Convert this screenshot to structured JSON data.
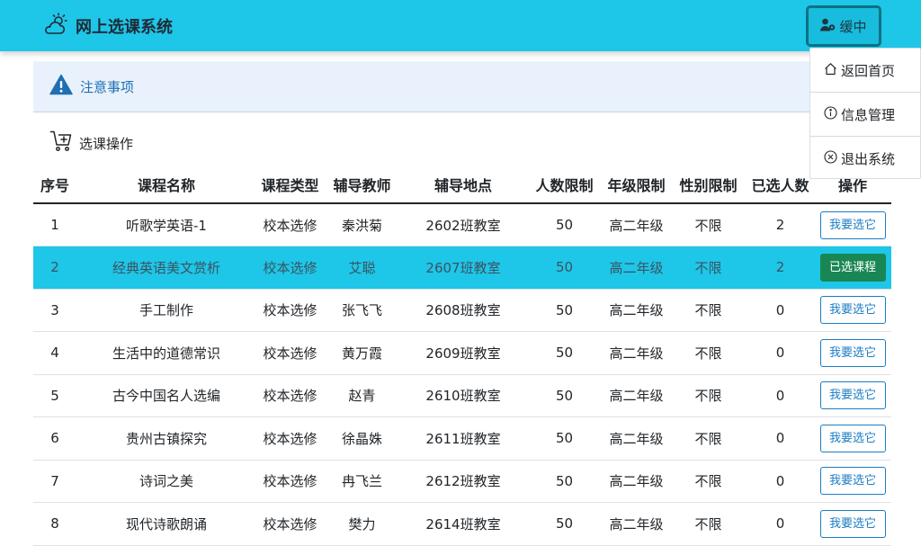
{
  "app": {
    "title": "网上选课系统",
    "logo_icon": "cloud-sun-icon"
  },
  "user": {
    "name": "缓中",
    "icon": "user-gear-icon"
  },
  "user_menu": [
    {
      "label": "返回首页",
      "icon": "home-icon"
    },
    {
      "label": "信息管理",
      "icon": "info-icon"
    },
    {
      "label": "退出系统",
      "icon": "close-circle-icon"
    }
  ],
  "notice": {
    "label": "注意事项",
    "icon": "warning-icon"
  },
  "operations": {
    "label": "选课操作",
    "icon": "cart-add-icon"
  },
  "table": {
    "headers": [
      "序号",
      "课程名称",
      "课程类型",
      "辅导教师",
      "辅导地点",
      "人数限制",
      "年级限制",
      "性别限制",
      "已选人数",
      "操作"
    ],
    "rows": [
      {
        "no": "1",
        "name": "听歌学英语-1",
        "type": "校本选修",
        "teacher": "秦洪菊",
        "location": "2602班教室",
        "limit": "50",
        "grade": "高二年级",
        "gender": "不限",
        "enrolled": "2",
        "action": "我要选它",
        "selected": false
      },
      {
        "no": "2",
        "name": "经典英语美文赏析",
        "type": "校本选修",
        "teacher": "艾聪",
        "location": "2607班教室",
        "limit": "50",
        "grade": "高二年级",
        "gender": "不限",
        "enrolled": "2",
        "action": "已选课程",
        "selected": true
      },
      {
        "no": "3",
        "name": "手工制作",
        "type": "校本选修",
        "teacher": "张飞飞",
        "location": "2608班教室",
        "limit": "50",
        "grade": "高二年级",
        "gender": "不限",
        "enrolled": "0",
        "action": "我要选它",
        "selected": false
      },
      {
        "no": "4",
        "name": "生活中的道德常识",
        "type": "校本选修",
        "teacher": "黄万霞",
        "location": "2609班教室",
        "limit": "50",
        "grade": "高二年级",
        "gender": "不限",
        "enrolled": "0",
        "action": "我要选它",
        "selected": false
      },
      {
        "no": "5",
        "name": "古今中国名人选编",
        "type": "校本选修",
        "teacher": "赵青",
        "location": "2610班教室",
        "limit": "50",
        "grade": "高二年级",
        "gender": "不限",
        "enrolled": "0",
        "action": "我要选它",
        "selected": false
      },
      {
        "no": "6",
        "name": "贵州古镇探究",
        "type": "校本选修",
        "teacher": "徐晶姝",
        "location": "2611班教室",
        "limit": "50",
        "grade": "高二年级",
        "gender": "不限",
        "enrolled": "0",
        "action": "我要选它",
        "selected": false
      },
      {
        "no": "7",
        "name": "诗词之美",
        "type": "校本选修",
        "teacher": "冉飞兰",
        "location": "2612班教室",
        "limit": "50",
        "grade": "高二年级",
        "gender": "不限",
        "enrolled": "0",
        "action": "我要选它",
        "selected": false
      },
      {
        "no": "8",
        "name": "现代诗歌朗诵",
        "type": "校本选修",
        "teacher": "樊力",
        "location": "2614班教室",
        "limit": "50",
        "grade": "高二年级",
        "gender": "不限",
        "enrolled": "0",
        "action": "我要选它",
        "selected": false
      }
    ]
  },
  "colors": {
    "navbar": "#1ec6e8",
    "selected_row": "#1ec6e8",
    "chosen_button": "#198754",
    "choose_button": "#1b7dc4"
  }
}
